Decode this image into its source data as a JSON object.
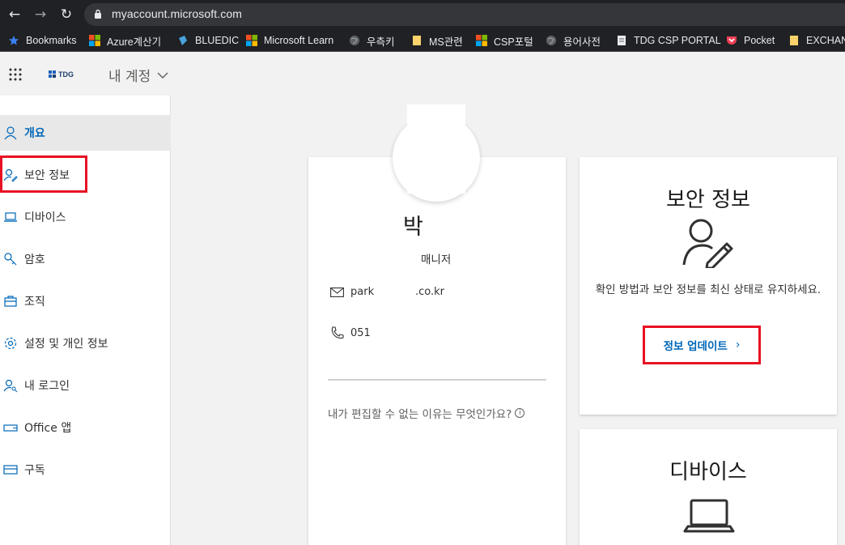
{
  "browser": {
    "url": "myaccount.microsoft.com",
    "bookmarks": [
      {
        "label": "Bookmarks",
        "icon": "star-icon"
      },
      {
        "label": "Azure계산기",
        "icon": "microsoft-logo-icon"
      },
      {
        "label": "BLUEDIC",
        "icon": "bluedic-icon"
      },
      {
        "label": "Microsoft Learn",
        "icon": "microsoft-logo-icon"
      },
      {
        "label": "우측키",
        "icon": "globe-icon"
      },
      {
        "label": "MS관련",
        "icon": "folder-icon"
      },
      {
        "label": "CSP포털",
        "icon": "microsoft-logo-icon"
      },
      {
        "label": "용어사전",
        "icon": "globe-icon"
      },
      {
        "label": "TDG CSP PORTAL",
        "icon": "document-icon"
      },
      {
        "label": "Pocket",
        "icon": "pocket-icon"
      },
      {
        "label": "EXCHAN",
        "icon": "folder-icon"
      }
    ]
  },
  "header": {
    "logo_text": "TDG",
    "title": "내 계정"
  },
  "sidebar": {
    "items": [
      {
        "label": "개요",
        "icon": "person-icon",
        "active": true
      },
      {
        "label": "보안 정보",
        "icon": "person-pen-icon",
        "active": false
      },
      {
        "label": "디바이스",
        "icon": "laptop-icon",
        "active": false
      },
      {
        "label": "암호",
        "icon": "key-icon",
        "active": false
      },
      {
        "label": "조직",
        "icon": "briefcase-icon",
        "active": false
      },
      {
        "label": "설정 및 개인 정보",
        "icon": "gear-icon",
        "active": false
      },
      {
        "label": "내 로그인",
        "icon": "person-key-icon",
        "active": false
      },
      {
        "label": "Office 앱",
        "icon": "apps-icon",
        "active": false
      },
      {
        "label": "구독",
        "icon": "card-icon",
        "active": false
      }
    ]
  },
  "profile": {
    "name": "박",
    "role": "매니저",
    "email_prefix": "park",
    "email_suffix": ".co.kr",
    "phone": "051",
    "why_text": "내가 편집할 수 없는 이유는 무엇인가요?",
    "info_glyph": "i"
  },
  "security_card": {
    "title": "보안 정보",
    "description": "확인 방법과 보안 정보를 최신 상태로 유지하세요.",
    "link_label": "정보 업데이트",
    "link_arrow": "›"
  },
  "devices_card": {
    "title": "디바이스"
  },
  "colors": {
    "accent": "#0067b8",
    "highlight": "#e81123"
  }
}
